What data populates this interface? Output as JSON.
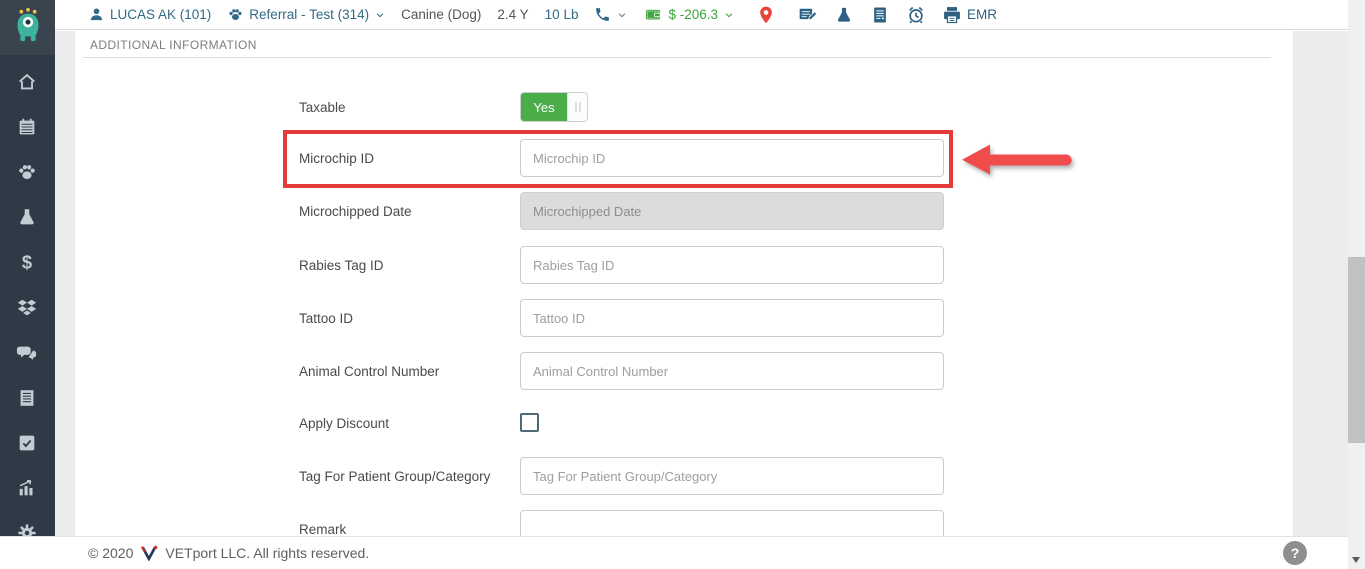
{
  "topbar": {
    "patient_label": "LUCAS AK (101)",
    "client_label": "Referral - Test (314)",
    "species": "Canine (Dog)",
    "age": "2.4 Y",
    "weight": "10 Lb",
    "balance": "$ -206.3",
    "emr_label": "EMR",
    "icons": [
      "patient-person-icon",
      "client-paw-icon",
      "phone-icon",
      "wallet-icon",
      "location-pin-icon",
      "planboard-pencil-icon",
      "lab-flask-icon",
      "document-info-icon",
      "alarm-clock-icon",
      "printer-emr-icon"
    ]
  },
  "sidebar": {
    "icons": [
      "monster-mascot-logo",
      "home-icon",
      "calendar-icon",
      "paw-icon",
      "flask-icon",
      "dollar-icon",
      "dropbox-icon",
      "chat-icon",
      "report-icon",
      "task-check-icon",
      "analytics-chart-icon",
      "gear-icon"
    ]
  },
  "section": {
    "title": "ADDITIONAL INFORMATION"
  },
  "form": {
    "taxable_label": "Taxable",
    "taxable_value": "Yes",
    "fields": [
      {
        "label": "Microchip ID",
        "placeholder": "Microchip ID",
        "type": "text",
        "state": "highlighted"
      },
      {
        "label": "Microchipped Date",
        "placeholder": "Microchipped Date",
        "type": "text",
        "state": "disabled"
      },
      {
        "label": "Rabies Tag ID",
        "placeholder": "Rabies Tag ID",
        "type": "text",
        "state": "normal"
      },
      {
        "label": "Tattoo ID",
        "placeholder": "Tattoo ID",
        "type": "text",
        "state": "normal"
      },
      {
        "label": "Animal Control Number",
        "placeholder": "Animal Control Number",
        "type": "text",
        "state": "normal"
      },
      {
        "label": "Apply Discount",
        "type": "checkbox",
        "checked": false
      },
      {
        "label": "Tag For Patient Group/Category",
        "placeholder": "Tag For Patient Group/Category",
        "type": "text",
        "state": "normal"
      },
      {
        "label": "Remark",
        "placeholder": "",
        "type": "text",
        "state": "normal"
      }
    ]
  },
  "annotations": {
    "highlight_target": "Microchip ID row",
    "arrow_direction": "left"
  },
  "footer": {
    "copyright": "© 2020",
    "rights": "VETport LLC. All rights reserved.",
    "help_label": "?"
  },
  "colors": {
    "sidebar_bg": "#2e3a45",
    "topbar_link_blue": "#336a87",
    "balance_green": "#3aa53a",
    "toggle_green": "#4aad4a",
    "pin_red": "#e8453c",
    "highlight_red": "#e33b3b",
    "arrow_red": "#f04c4c",
    "disabled_input_bg": "#dcdcdc",
    "content_bg": "#ececec",
    "mascot_teal": "#3db39e"
  }
}
